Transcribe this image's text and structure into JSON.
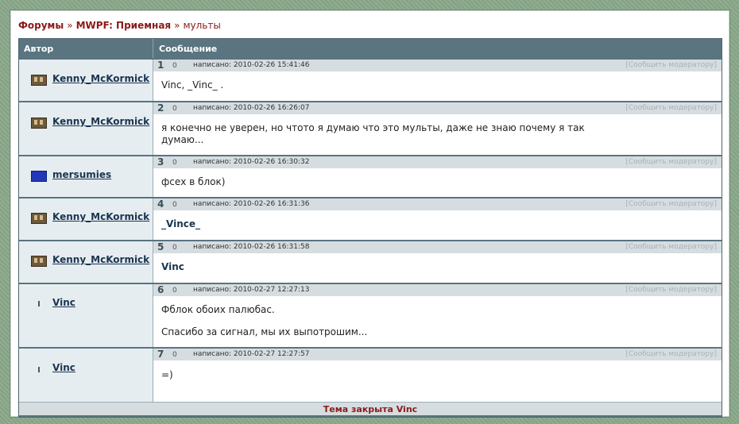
{
  "breadcrumb": {
    "forums": "Форумы",
    "sep1": "»",
    "section": "MWPF: Приемная",
    "sep2": "»",
    "topic": "мульты"
  },
  "table": {
    "col_author": "Автор",
    "col_message": "Сообщение"
  },
  "posts": [
    {
      "num": "1",
      "karma": "0",
      "meta": "написано: 2010-02-26 15:41:46",
      "report": "[Сообщить модератору]",
      "author": "Kenny_McKormick",
      "avatar": "face-avatar",
      "lines": [
        "Vinc, _Vinc_ ."
      ]
    },
    {
      "num": "2",
      "karma": "0",
      "meta": "написано: 2010-02-26 16:26:07",
      "report": "[Сообщить модератору]",
      "author": "Kenny_McKormick",
      "avatar": "face-avatar",
      "lines": [
        "я конечно не уверен, но чтото я думаю что это мульты, даже не знаю почему я так",
        "думаю..."
      ]
    },
    {
      "num": "3",
      "karma": "0",
      "meta": "написано: 2010-02-26 16:30:32",
      "report": "[Сообщить модератору]",
      "author": "mersumies",
      "avatar": "flag-avatar",
      "lines": [
        "фсех в блок)"
      ]
    },
    {
      "num": "4",
      "karma": "0",
      "meta": "написано: 2010-02-26 16:31:36",
      "report": "[Сообщить модератору]",
      "author": "Kenny_McKormick",
      "avatar": "face-avatar",
      "lines": [
        "_Vince_"
      ]
    },
    {
      "num": "5",
      "karma": "0",
      "meta": "написано: 2010-02-26 16:31:58",
      "report": "[Сообщить модератору]",
      "author": "Kenny_McKormick",
      "avatar": "face-avatar",
      "lines": [
        "Vinc"
      ]
    },
    {
      "num": "6",
      "karma": "0",
      "meta": "написано: 2010-02-27 12:27:13",
      "report": "[Сообщить модератору]",
      "author": "Vinc",
      "avatar": "dot-avatar",
      "lines": [
        "Фблок обоих палюбас.",
        "Спасибо за сигнал, мы их выпотрошим..."
      ]
    },
    {
      "num": "7",
      "karma": "0",
      "meta": "написано: 2010-02-27 12:27:57",
      "report": "[Сообщить модератору]",
      "author": "Vinc",
      "avatar": "dot-avatar",
      "lines": [
        "=)"
      ]
    }
  ],
  "footer": {
    "closed": "Тема закрыта Vinc"
  }
}
